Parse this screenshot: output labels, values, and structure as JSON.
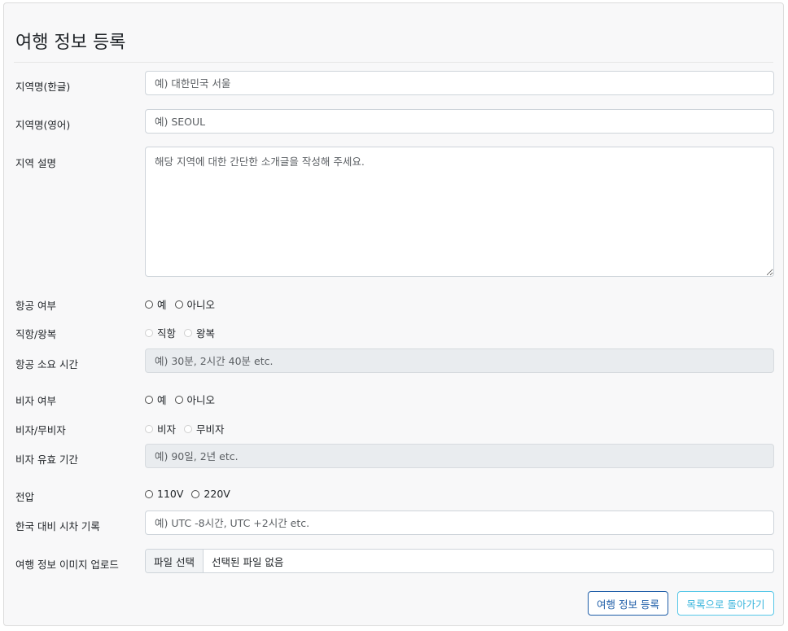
{
  "page": {
    "title": "여행 정보 등록"
  },
  "form": {
    "region_kr": {
      "label": "지역명(한글)",
      "placeholder": "예) 대한민국 서울"
    },
    "region_en": {
      "label": "지역명(영어)",
      "placeholder": "예) SEOUL"
    },
    "region_desc": {
      "label": "지역 설명",
      "placeholder": "해당 지역에 대한 간단한 소개글을 작성해 주세요."
    },
    "flight": {
      "label": "항공 여부",
      "options": [
        "예",
        "아니오"
      ]
    },
    "flight_type": {
      "label": "직항/왕복",
      "options": [
        "직항",
        "왕복"
      ]
    },
    "flight_time": {
      "label": "항공 소요 시간",
      "placeholder": "예) 30분, 2시간 40분 etc."
    },
    "visa": {
      "label": "비자 여부",
      "options": [
        "예",
        "아니오"
      ]
    },
    "visa_type": {
      "label": "비자/무비자",
      "options": [
        "비자",
        "무비자"
      ]
    },
    "visa_period": {
      "label": "비자 유효 기간",
      "placeholder": "예) 90일, 2년 etc."
    },
    "voltage": {
      "label": "전압",
      "options": [
        "110V",
        "220V"
      ]
    },
    "time_diff": {
      "label": "한국 대비 시차 기록",
      "placeholder": "예) UTC -8시간, UTC +2시간 etc."
    },
    "image_upload": {
      "label": "여행 정보 이미지 업로드",
      "button": "파일 선택",
      "status": "선택된 파일 없음"
    }
  },
  "actions": {
    "submit": "여행 정보 등록",
    "back": "목록으로 돌아가기"
  },
  "colors": {
    "primary": "#1f5ea8",
    "info": "#56c7e8",
    "card_bg": "#f8f8f9",
    "disabled_bg": "#e9ecef"
  }
}
